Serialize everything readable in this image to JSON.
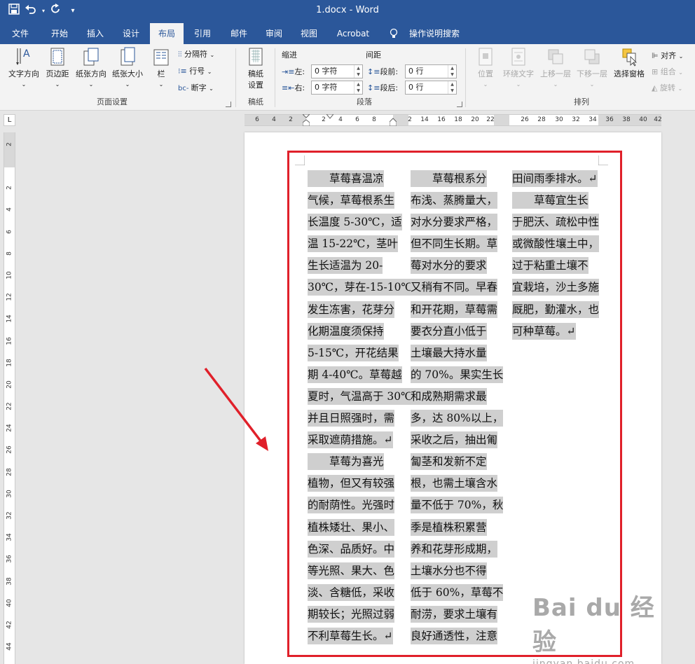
{
  "app": {
    "doc_title": "1.docx  -  Word"
  },
  "qat": {
    "save_icon": "save-icon",
    "undo_icon": "undo-icon",
    "redo_icon": "redo-icon",
    "customize_icon": "customize-icon"
  },
  "tabs": [
    {
      "label": "文件"
    },
    {
      "label": "开始"
    },
    {
      "label": "插入"
    },
    {
      "label": "设计"
    },
    {
      "label": "布局",
      "active": true
    },
    {
      "label": "引用"
    },
    {
      "label": "邮件"
    },
    {
      "label": "审阅"
    },
    {
      "label": "视图"
    },
    {
      "label": "Acrobat"
    },
    {
      "label": "操作说明搜索"
    }
  ],
  "ribbon": {
    "page_setup": {
      "text_direction": "文字方向",
      "margins": "页边距",
      "orientation": "纸张方向",
      "size": "纸张大小",
      "columns": "栏",
      "breaks": "分隔符",
      "line_numbers": "行号",
      "hyphenation": "断字",
      "group_label": "页面设置"
    },
    "manuscript": {
      "settings_line1": "稿纸",
      "settings_line2": "设置",
      "group_label": "稿纸"
    },
    "paragraph": {
      "indent_title": "缩进",
      "spacing_title": "间距",
      "left_label": "左:",
      "right_label": "右:",
      "left_value": "0 字符",
      "right_value": "0 字符",
      "before_label": "段前:",
      "after_label": "段后:",
      "before_value": "0 行",
      "after_value": "0 行",
      "group_label": "段落"
    },
    "arrange": {
      "position": "位置",
      "wrap_text": "环绕文字",
      "bring_forward": "上移一层",
      "send_backward": "下移一层",
      "selection_pane": "选择窗格",
      "align": "对齐",
      "group": "组合",
      "rotate": "旋转",
      "group_label": "排列"
    }
  },
  "ruler": {
    "corner": "L",
    "h_numbers": [
      "6",
      "4",
      "2",
      "2",
      "4",
      "6",
      "8",
      "2",
      "14",
      "16",
      "18",
      "20",
      "22",
      "26",
      "28",
      "30",
      "32",
      "34",
      "36",
      "38",
      "40",
      "42"
    ],
    "v_numbers": [
      "2",
      "2",
      "4",
      "6",
      "8",
      "10",
      "12",
      "14",
      "16",
      "18",
      "20",
      "22",
      "24",
      "26",
      "28",
      "30",
      "32",
      "34",
      "36",
      "38",
      "40",
      "42",
      "44"
    ]
  },
  "document": {
    "col1": [
      "　　草莓喜温凉",
      "气候，草莓根系生",
      "长温度 5-30℃，适",
      "温 15-22℃，茎叶",
      "生长适温为 20-",
      "30℃，芽在-15-10℃",
      "发生冻害，花芽分",
      "化期温度须保持",
      "5-15℃，开花结果",
      "期 4-40℃。草莓越",
      "夏时，气温高于 30℃",
      "并且日照强时，需",
      "采取遮荫措施。↵",
      "　　草莓为喜光",
      "植物，但又有较强",
      "的耐荫性。光强时",
      "植株矮壮、果小、",
      "色深、品质好。中",
      "等光照、果大、色",
      "淡、含糖低，采收",
      "期较长；光照过弱",
      "不利草莓生长。↵"
    ],
    "col2": [
      "　　草莓根系分",
      "布浅、蒸腾量大，",
      "对水分要求严格，",
      "但不同生长期。草",
      "莓对水分的要求",
      "又稍有不同。早春",
      "和开花期，草莓需",
      "要衣分直小低于",
      "土壤最大持水量",
      "的 70%。果实生长",
      "和成熟期需求最",
      "多，达 80%以上，",
      "采收之后，抽出匍",
      "匐茎和发新不定",
      "根，也需土壤含水",
      "量不低于 70%，秋",
      "季是植株积累营",
      "养和花芽形成期，",
      "土壤水分也不得",
      "低于 60%，草莓不",
      "耐涝，要求土壤有",
      "良好通透性，注意"
    ],
    "col3": [
      "田间雨季排水。↵",
      "　　草莓宜生长",
      "于肥沃、疏松中性",
      "或微酸性壤土中，",
      "过于粘重土壤不",
      "宜栽培，沙土多施",
      "厩肥，勤灌水，也",
      "可种草莓。↵"
    ]
  },
  "watermark": {
    "line1": "Bai du 经验",
    "line2": "jingyan.baidu.com"
  },
  "colors": {
    "title_bar": "#2b579a",
    "highlight_box": "#e0202a",
    "text_shading": "#cfcfcf"
  }
}
